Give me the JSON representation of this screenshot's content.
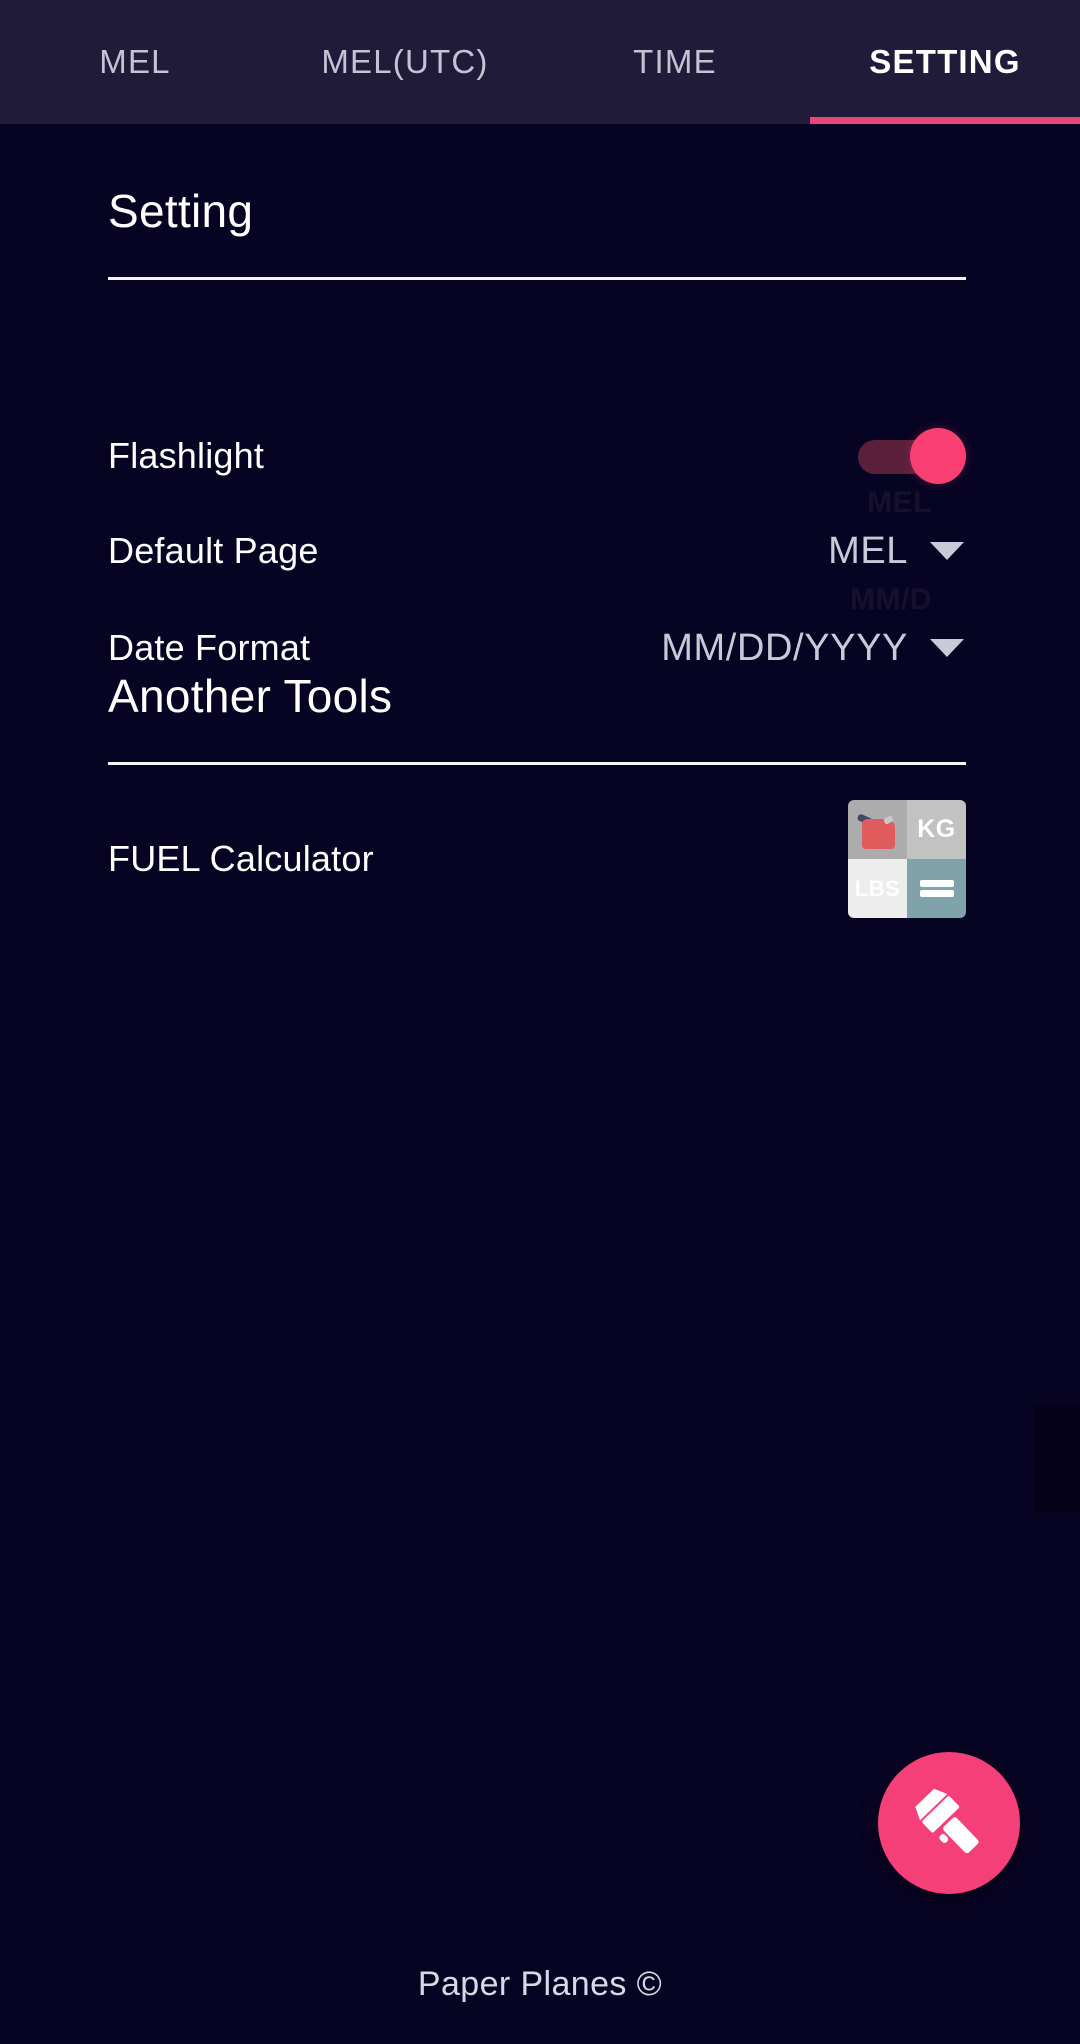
{
  "theme": {
    "background": "#070322",
    "tabbar_background": "#211B3A",
    "accent_pink": "#E8437A",
    "fab_pink": "#F43F78",
    "toggle_thumb": "#FA3F72",
    "toggle_track": "#5B1F3C",
    "text_primary": "#FFFFFF",
    "text_muted": "#C3C3D4",
    "divider": "#F3F3F8"
  },
  "tabs": [
    {
      "label": "MEL",
      "active": false
    },
    {
      "label": "MEL(UTC)",
      "active": false
    },
    {
      "label": "TIME",
      "active": false
    },
    {
      "label": "SETTING",
      "active": true
    }
  ],
  "setting_section": {
    "title": "Setting",
    "rows": {
      "flashlight": {
        "label": "Flashlight",
        "control": "toggle",
        "state": "on"
      },
      "default_page": {
        "label": "Default Page",
        "control": "dropdown",
        "value": "MEL",
        "ghost_label": "MEL"
      },
      "date_format": {
        "label": "Date Format",
        "control": "dropdown",
        "value": "MM/DD/YYYY",
        "ghost_label": "MM/D"
      }
    }
  },
  "tools_section": {
    "title": "Another Tools",
    "rows": {
      "fuel_calculator": {
        "label": "FUEL Calculator",
        "icon": "fuel-calculator-icon",
        "icon_cells": {
          "top_left": "fuel-can",
          "top_right": "KG",
          "bottom_left": "LBS",
          "bottom_right": "="
        }
      }
    }
  },
  "fab": {
    "icon": "flashlight-icon"
  },
  "footer": {
    "text": "Paper Planes ©"
  }
}
